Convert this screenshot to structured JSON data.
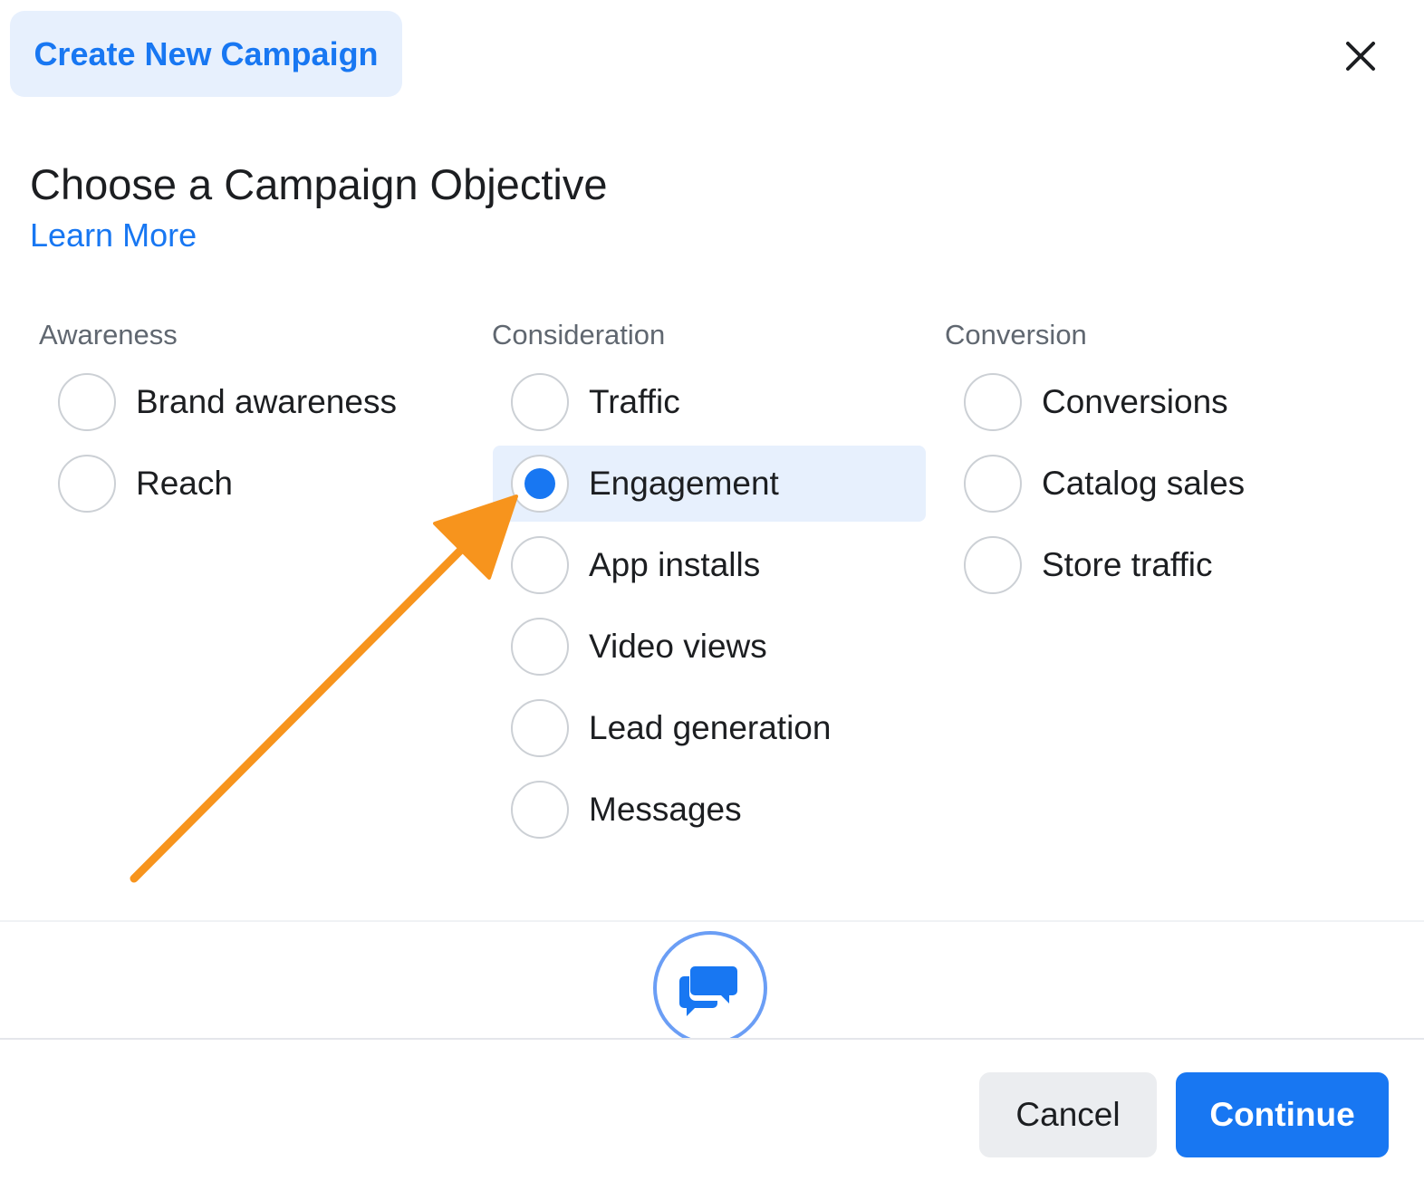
{
  "header": {
    "tab_label": "Create New Campaign",
    "close_icon": "close-icon"
  },
  "main": {
    "title": "Choose a Campaign Objective",
    "learn_more": "Learn More"
  },
  "objectives": {
    "awareness": {
      "header": "Awareness",
      "options": [
        {
          "label": "Brand awareness",
          "selected": false
        },
        {
          "label": "Reach",
          "selected": false
        }
      ]
    },
    "consideration": {
      "header": "Consideration",
      "options": [
        {
          "label": "Traffic",
          "selected": false
        },
        {
          "label": "Engagement",
          "selected": true
        },
        {
          "label": "App installs",
          "selected": false
        },
        {
          "label": "Video views",
          "selected": false
        },
        {
          "label": "Lead generation",
          "selected": false
        },
        {
          "label": "Messages",
          "selected": false
        }
      ]
    },
    "conversion": {
      "header": "Conversion",
      "options": [
        {
          "label": "Conversions",
          "selected": false
        },
        {
          "label": "Catalog sales",
          "selected": false
        },
        {
          "label": "Store traffic",
          "selected": false
        }
      ]
    }
  },
  "footer": {
    "cancel_label": "Cancel",
    "continue_label": "Continue",
    "chat_icon": "chat-bubbles-icon"
  },
  "colors": {
    "accent": "#1877f2",
    "selected_bg": "#e7f0fd",
    "annotation_arrow": "#f7941d"
  }
}
